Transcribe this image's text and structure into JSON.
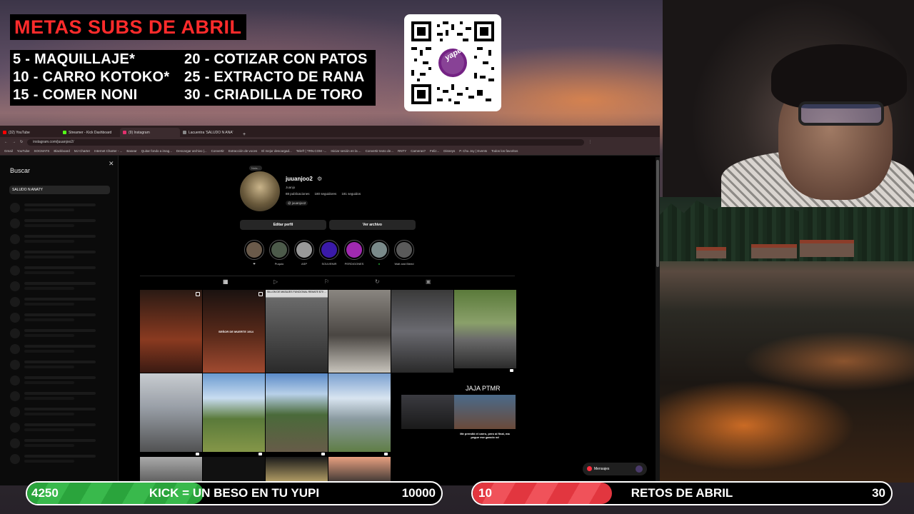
{
  "overlay": {
    "goals_title": "METAS SUBS DE ABRIL",
    "goals": [
      "5 -   MAQUILLAJE*",
      "10 - CARRO KOTOKO*",
      "15 - COMER NONI",
      "20 - COTIZAR CON PATOS",
      "25 - EXTRACTO DE RANA",
      "30 - CRIADILLA DE TORO"
    ],
    "qr_brand": "yape",
    "kick_bar": {
      "current": "4250",
      "text": "KICK = UN BESO EN TU YUPI",
      "goal": "10000",
      "progress": 0.425,
      "color": "#2aa43c"
    },
    "retos_bar": {
      "current": "10",
      "text": "RETOS DE ABRIL",
      "goal": "30",
      "progress": 0.333,
      "color": "#e2363f"
    }
  },
  "browser": {
    "tabs": [
      {
        "label": "(32) YouTube",
        "icon_color": "#ff0000"
      },
      {
        "label": "Streamer - Kick Dashboard",
        "icon_color": "#53fc18"
      },
      {
        "label": "(9) Instagram",
        "icon_color": "#e1306c"
      },
      {
        "label": "Lacuentra 'SALUDO N ANA'",
        "icon_color": "#888888"
      }
    ],
    "url": "instagram.com/juuanjoo2/",
    "bookmarks": [
      "Gmail",
      "YouTube",
      "SOCMATS",
      "Blackboard",
      "MJ Charter",
      "Internet Charter - ...",
      "Basear",
      "Quitar fondo a imag...",
      "Descargar archivo |...",
      "Convertir",
      "Extracción de voces",
      "El mejor descargad...",
      "Tele® | TRN.COM -...",
      "Iniciar sesión en la ...",
      "Convertir texto de...",
      "RNTY",
      "Cameras?",
      "Feliz...",
      "Disneys",
      "P. Chu Joy | Events",
      "Todos los favoritos"
    ]
  },
  "search": {
    "title": "Buscar",
    "query": "SALUDO N ANATY"
  },
  "profile": {
    "note": "Nota...",
    "username": "juuanjoo2",
    "full_name": "Juanjo",
    "stats": [
      "88 publicaciones",
      "180 seguidores",
      "181 seguidos"
    ],
    "threads_handle": "@ juuanjoo2",
    "edit_button": "Editar perfil",
    "archive_button": "Ver archivo",
    "highlights": [
      "❤",
      "Puquio",
      "ASP",
      "SOUVENIR",
      "PERDIGONES",
      "●",
      "Walt and Bleed"
    ],
    "tab_icons": [
      "▦",
      "▷",
      "⚐",
      "↻",
      "▣"
    ],
    "post_captions": [
      "JAJA PTMR",
      "Me prendió el carro, pero al final, ma pegue ese gancio xd",
      "SILLON DE MASAJES FUNCIONAL REMATE $70 ...",
      "SEÑOR DE MUERTE 1914"
    ],
    "messages_label": "Mensajes"
  }
}
